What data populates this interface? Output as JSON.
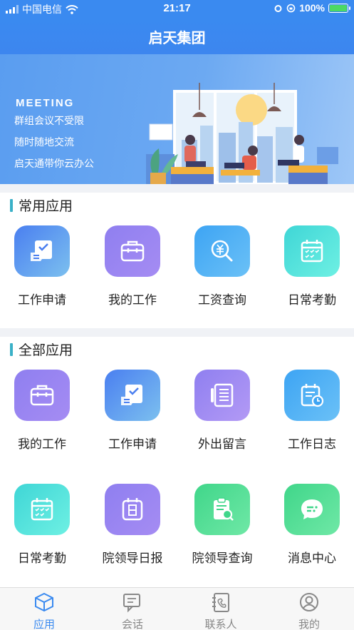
{
  "status": {
    "carrier": "中国电信",
    "time": "21:17",
    "battery": "100%"
  },
  "header": {
    "title": "启天集团"
  },
  "banner": {
    "heading": "MEETING",
    "lines": [
      "群组会议不受限",
      "随时随地交流",
      "启天通带你云办公"
    ]
  },
  "common_section": {
    "title": "常用应用",
    "apps": [
      {
        "label": "工作申请",
        "icon": "form-check-icon",
        "color_from": "#4a7ff0",
        "color_to": "#7cc0ef"
      },
      {
        "label": "我的工作",
        "icon": "briefcase-icon",
        "color_from": "#8f7ff0",
        "color_to": "#a58cf3"
      },
      {
        "label": "工资查询",
        "icon": "salary-search-icon",
        "color_from": "#3da4f3",
        "color_to": "#6bc1f7"
      },
      {
        "label": "日常考勤",
        "icon": "calendar-icon",
        "color_from": "#3fd6d6",
        "color_to": "#6ef0e3"
      }
    ]
  },
  "all_section": {
    "title": "全部应用",
    "apps": [
      {
        "label": "我的工作",
        "icon": "briefcase-icon"
      },
      {
        "label": "工作申请",
        "icon": "form-check-icon"
      },
      {
        "label": "外出留言",
        "icon": "notebook-icon"
      },
      {
        "label": "工作日志",
        "icon": "calendar-clock-icon"
      },
      {
        "label": "日常考勤",
        "icon": "calendar-icon"
      },
      {
        "label": "院领导日报",
        "icon": "daily-report-icon"
      },
      {
        "label": "院领导查询",
        "icon": "clipboard-search-icon"
      },
      {
        "label": "消息中心",
        "icon": "chat-bubble-icon"
      }
    ]
  },
  "tabs": [
    {
      "label": "应用",
      "icon": "cube-icon",
      "active": true
    },
    {
      "label": "会话",
      "icon": "chat-icon",
      "active": false
    },
    {
      "label": "联系人",
      "icon": "contacts-icon",
      "active": false
    },
    {
      "label": "我的",
      "icon": "user-icon",
      "active": false
    }
  ],
  "colors": {
    "primary": "#3a8af0",
    "section_mark": "#3ab0c7",
    "tab_inactive": "#888888"
  }
}
